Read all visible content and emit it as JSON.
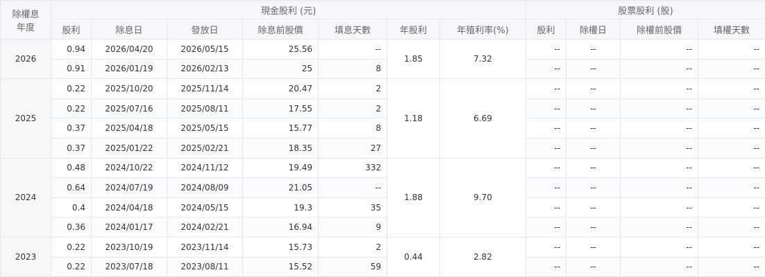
{
  "header": {
    "year_label_line1": "除權息",
    "year_label_line2": "年度",
    "cash_group": "現金股利 (元)",
    "stock_group": "股票股利 (股)",
    "cash_cols": [
      "股利",
      "除息日",
      "發放日",
      "除息前股價",
      "填息天數",
      "年股利",
      "年殖利率(%)"
    ],
    "stock_cols": [
      "股利",
      "除權日",
      "除權前股價",
      "填權天數"
    ]
  },
  "groups": [
    {
      "year": "2026",
      "annual_dividend": "1.85",
      "annual_yield": "7.32",
      "rows": [
        {
          "div": "0.94",
          "ex_date": "2026/04/20",
          "pay_date": "2026/05/15",
          "pre_price": "25.56",
          "fill_days": "--",
          "s_div": "--",
          "s_date": "--",
          "s_price": "--",
          "s_days": "--"
        },
        {
          "div": "0.91",
          "ex_date": "2026/01/19",
          "pay_date": "2026/02/13",
          "pre_price": "25",
          "fill_days": "8",
          "s_div": "--",
          "s_date": "--",
          "s_price": "--",
          "s_days": "--"
        }
      ]
    },
    {
      "year": "2025",
      "annual_dividend": "1.18",
      "annual_yield": "6.69",
      "rows": [
        {
          "div": "0.22",
          "ex_date": "2025/10/20",
          "pay_date": "2025/11/14",
          "pre_price": "20.47",
          "fill_days": "2",
          "s_div": "--",
          "s_date": "--",
          "s_price": "--",
          "s_days": "--"
        },
        {
          "div": "0.22",
          "ex_date": "2025/07/16",
          "pay_date": "2025/08/11",
          "pre_price": "17.55",
          "fill_days": "2",
          "s_div": "--",
          "s_date": "--",
          "s_price": "--",
          "s_days": "--"
        },
        {
          "div": "0.37",
          "ex_date": "2025/04/18",
          "pay_date": "2025/05/15",
          "pre_price": "15.77",
          "fill_days": "8",
          "s_div": "--",
          "s_date": "--",
          "s_price": "--",
          "s_days": "--"
        },
        {
          "div": "0.37",
          "ex_date": "2025/01/22",
          "pay_date": "2025/02/21",
          "pre_price": "18.35",
          "fill_days": "27",
          "s_div": "--",
          "s_date": "--",
          "s_price": "--",
          "s_days": "--"
        }
      ]
    },
    {
      "year": "2024",
      "annual_dividend": "1.88",
      "annual_yield": "9.70",
      "rows": [
        {
          "div": "0.48",
          "ex_date": "2024/10/22",
          "pay_date": "2024/11/12",
          "pre_price": "19.49",
          "fill_days": "332",
          "s_div": "--",
          "s_date": "--",
          "s_price": "--",
          "s_days": "--"
        },
        {
          "div": "0.64",
          "ex_date": "2024/07/19",
          "pay_date": "2024/08/09",
          "pre_price": "21.05",
          "fill_days": "--",
          "s_div": "--",
          "s_date": "--",
          "s_price": "--",
          "s_days": "--"
        },
        {
          "div": "0.4",
          "ex_date": "2024/04/18",
          "pay_date": "2024/05/15",
          "pre_price": "19.3",
          "fill_days": "35",
          "s_div": "--",
          "s_date": "--",
          "s_price": "--",
          "s_days": "--"
        },
        {
          "div": "0.36",
          "ex_date": "2024/01/17",
          "pay_date": "2024/02/21",
          "pre_price": "16.94",
          "fill_days": "9",
          "s_div": "--",
          "s_date": "--",
          "s_price": "--",
          "s_days": "--"
        }
      ]
    },
    {
      "year": "2023",
      "annual_dividend": "0.44",
      "annual_yield": "2.82",
      "rows": [
        {
          "div": "0.22",
          "ex_date": "2023/10/19",
          "pay_date": "2023/11/14",
          "pre_price": "15.73",
          "fill_days": "2",
          "s_div": "--",
          "s_date": "--",
          "s_price": "--",
          "s_days": "--"
        },
        {
          "div": "0.22",
          "ex_date": "2023/07/18",
          "pay_date": "2023/08/11",
          "pre_price": "15.52",
          "fill_days": "59",
          "s_div": "--",
          "s_date": "--",
          "s_price": "--",
          "s_days": "--"
        }
      ]
    }
  ]
}
